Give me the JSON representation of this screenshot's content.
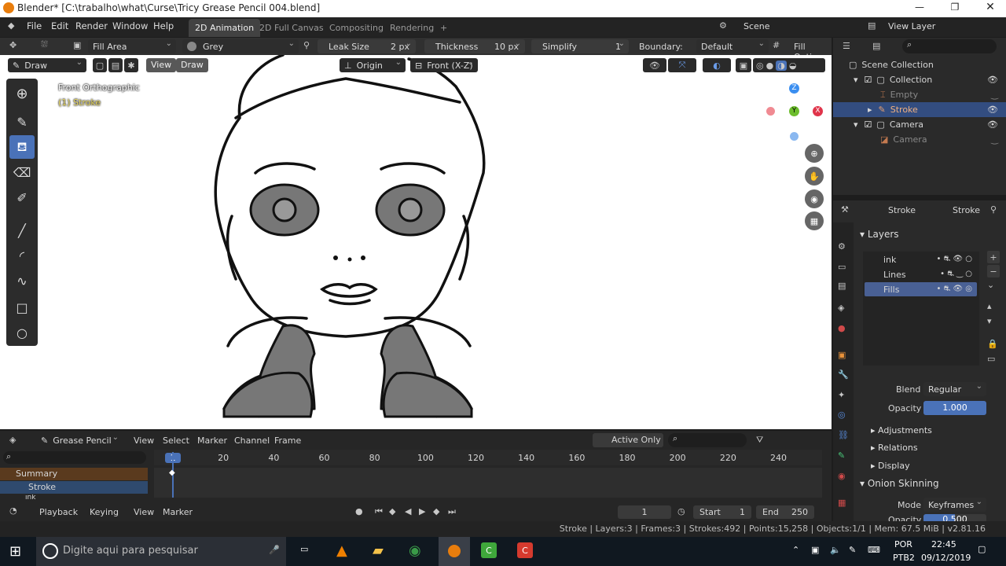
{
  "window": {
    "title": "Blender* [C:\\trabalho\\what\\Curse\\Tricy Grease Pencil 004.blend]"
  },
  "menu": [
    "File",
    "Edit",
    "Render",
    "Window",
    "Help"
  ],
  "workspaces": [
    "2D Animation",
    "2D Full Canvas",
    "Compositing",
    "Rendering",
    "+"
  ],
  "scene": {
    "label": "Scene",
    "view_layer": "View Layer"
  },
  "tool_header": {
    "mode": "Fill Area",
    "material": "Grey",
    "leak_size_label": "Leak Size",
    "leak_size_value": "2 px",
    "thickness_label": "Thickness",
    "thickness_value": "10 px",
    "simplify_label": "Simplify",
    "simplify_value": "1",
    "boundary_label": "Boundary:",
    "boundary_value": "Default",
    "fill_options": "Fill Option"
  },
  "viewport_header": {
    "mode": "Draw",
    "view": "View",
    "draw": "Draw",
    "origin": "Origin",
    "orientation": "Front (X-Z)"
  },
  "viewport_overlay": {
    "view_name": "Front Orthographic",
    "object": "(1) Stroke"
  },
  "gizmo": {
    "z": "Z",
    "y": "Y",
    "x": "X"
  },
  "outliner": {
    "root": "Scene Collection",
    "items": [
      {
        "name": "Collection",
        "level": 1
      },
      {
        "name": "Empty",
        "level": 2
      },
      {
        "name": "Stroke",
        "level": 2
      },
      {
        "name": "Camera",
        "level": 1
      },
      {
        "name": "Camera",
        "level": 2
      }
    ]
  },
  "properties": {
    "header_obj": "Stroke",
    "header_data": "Stroke",
    "layers_label": "Layers",
    "layers": [
      "ink",
      "Lines",
      "Fills"
    ],
    "blend_label": "Blend",
    "blend_value": "Regular",
    "opacity_label": "Opacity",
    "opacity_value": "1.000",
    "sections": [
      "Adjustments",
      "Relations",
      "Display"
    ],
    "onion_label": "Onion Skinning",
    "mode_label": "Mode",
    "mode_value": "Keyframes",
    "opacity2_label": "Opacity",
    "opacity2_value": "0.500"
  },
  "timeline": {
    "editor": "Grease Pencil",
    "menu": [
      "View",
      "Select",
      "Marker",
      "Channel",
      "Frame"
    ],
    "active_only": "Active Only",
    "ticks": [
      "1",
      "20",
      "40",
      "60",
      "80",
      "100",
      "120",
      "140",
      "160",
      "180",
      "200",
      "220",
      "240"
    ],
    "channels": [
      "Summary",
      "Stroke",
      "ink"
    ],
    "playback": "Playback",
    "keying": "Keying",
    "view": "View",
    "marker": "Marker",
    "current_frame": "1",
    "start_label": "Start",
    "start": "1",
    "end_label": "End",
    "end": "250"
  },
  "status": "Stroke | Layers:3 | Frames:3 | Strokes:492 | Points:15,258 | Objects:1/1 | Mem: 67.5 MiB | v2.81.16",
  "taskbar": {
    "search": "Digite aqui para pesquisar",
    "lang1": "POR",
    "lang2": "PTB2",
    "time": "22:45",
    "date": "09/12/2019"
  },
  "colors": {
    "accent": "#4a72b8",
    "selected_row": "#334d80",
    "summary": "#5a3a1e",
    "stroke_channel": "#2f4a6e"
  }
}
